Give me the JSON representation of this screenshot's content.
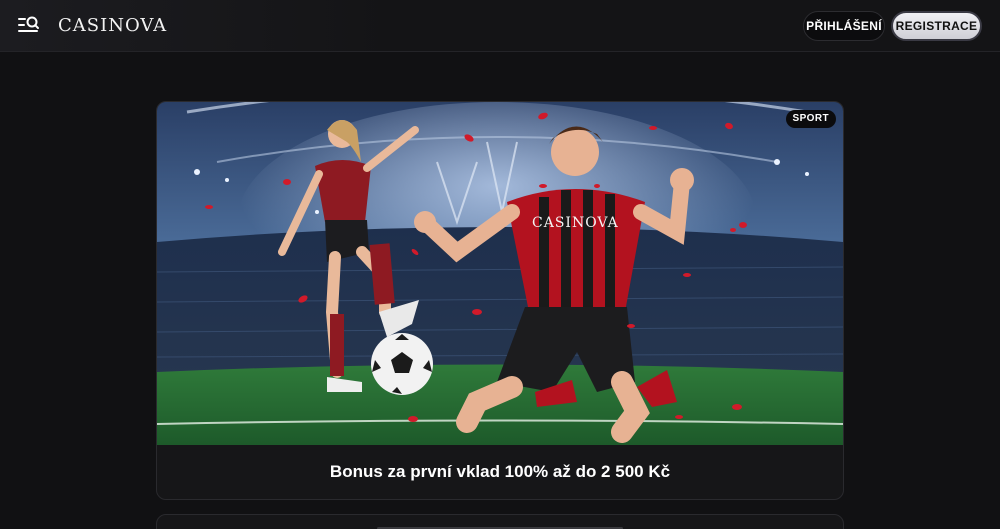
{
  "header": {
    "logo_text": "CASINOVA",
    "login_label": "PŘIHLÁŠENÍ",
    "register_label": "REGISTRACE",
    "menu_icon": "menu-search-icon"
  },
  "promo": {
    "badge": "SPORT",
    "title": "Bonus za první vklad 100% až do 2 500 Kč",
    "jersey_text": "CASINOVA"
  },
  "colors": {
    "background": "#111113",
    "jersey_red": "#b3121f",
    "jersey_black": "#1a1a1a",
    "pitch_green": "#2f7a3a"
  }
}
